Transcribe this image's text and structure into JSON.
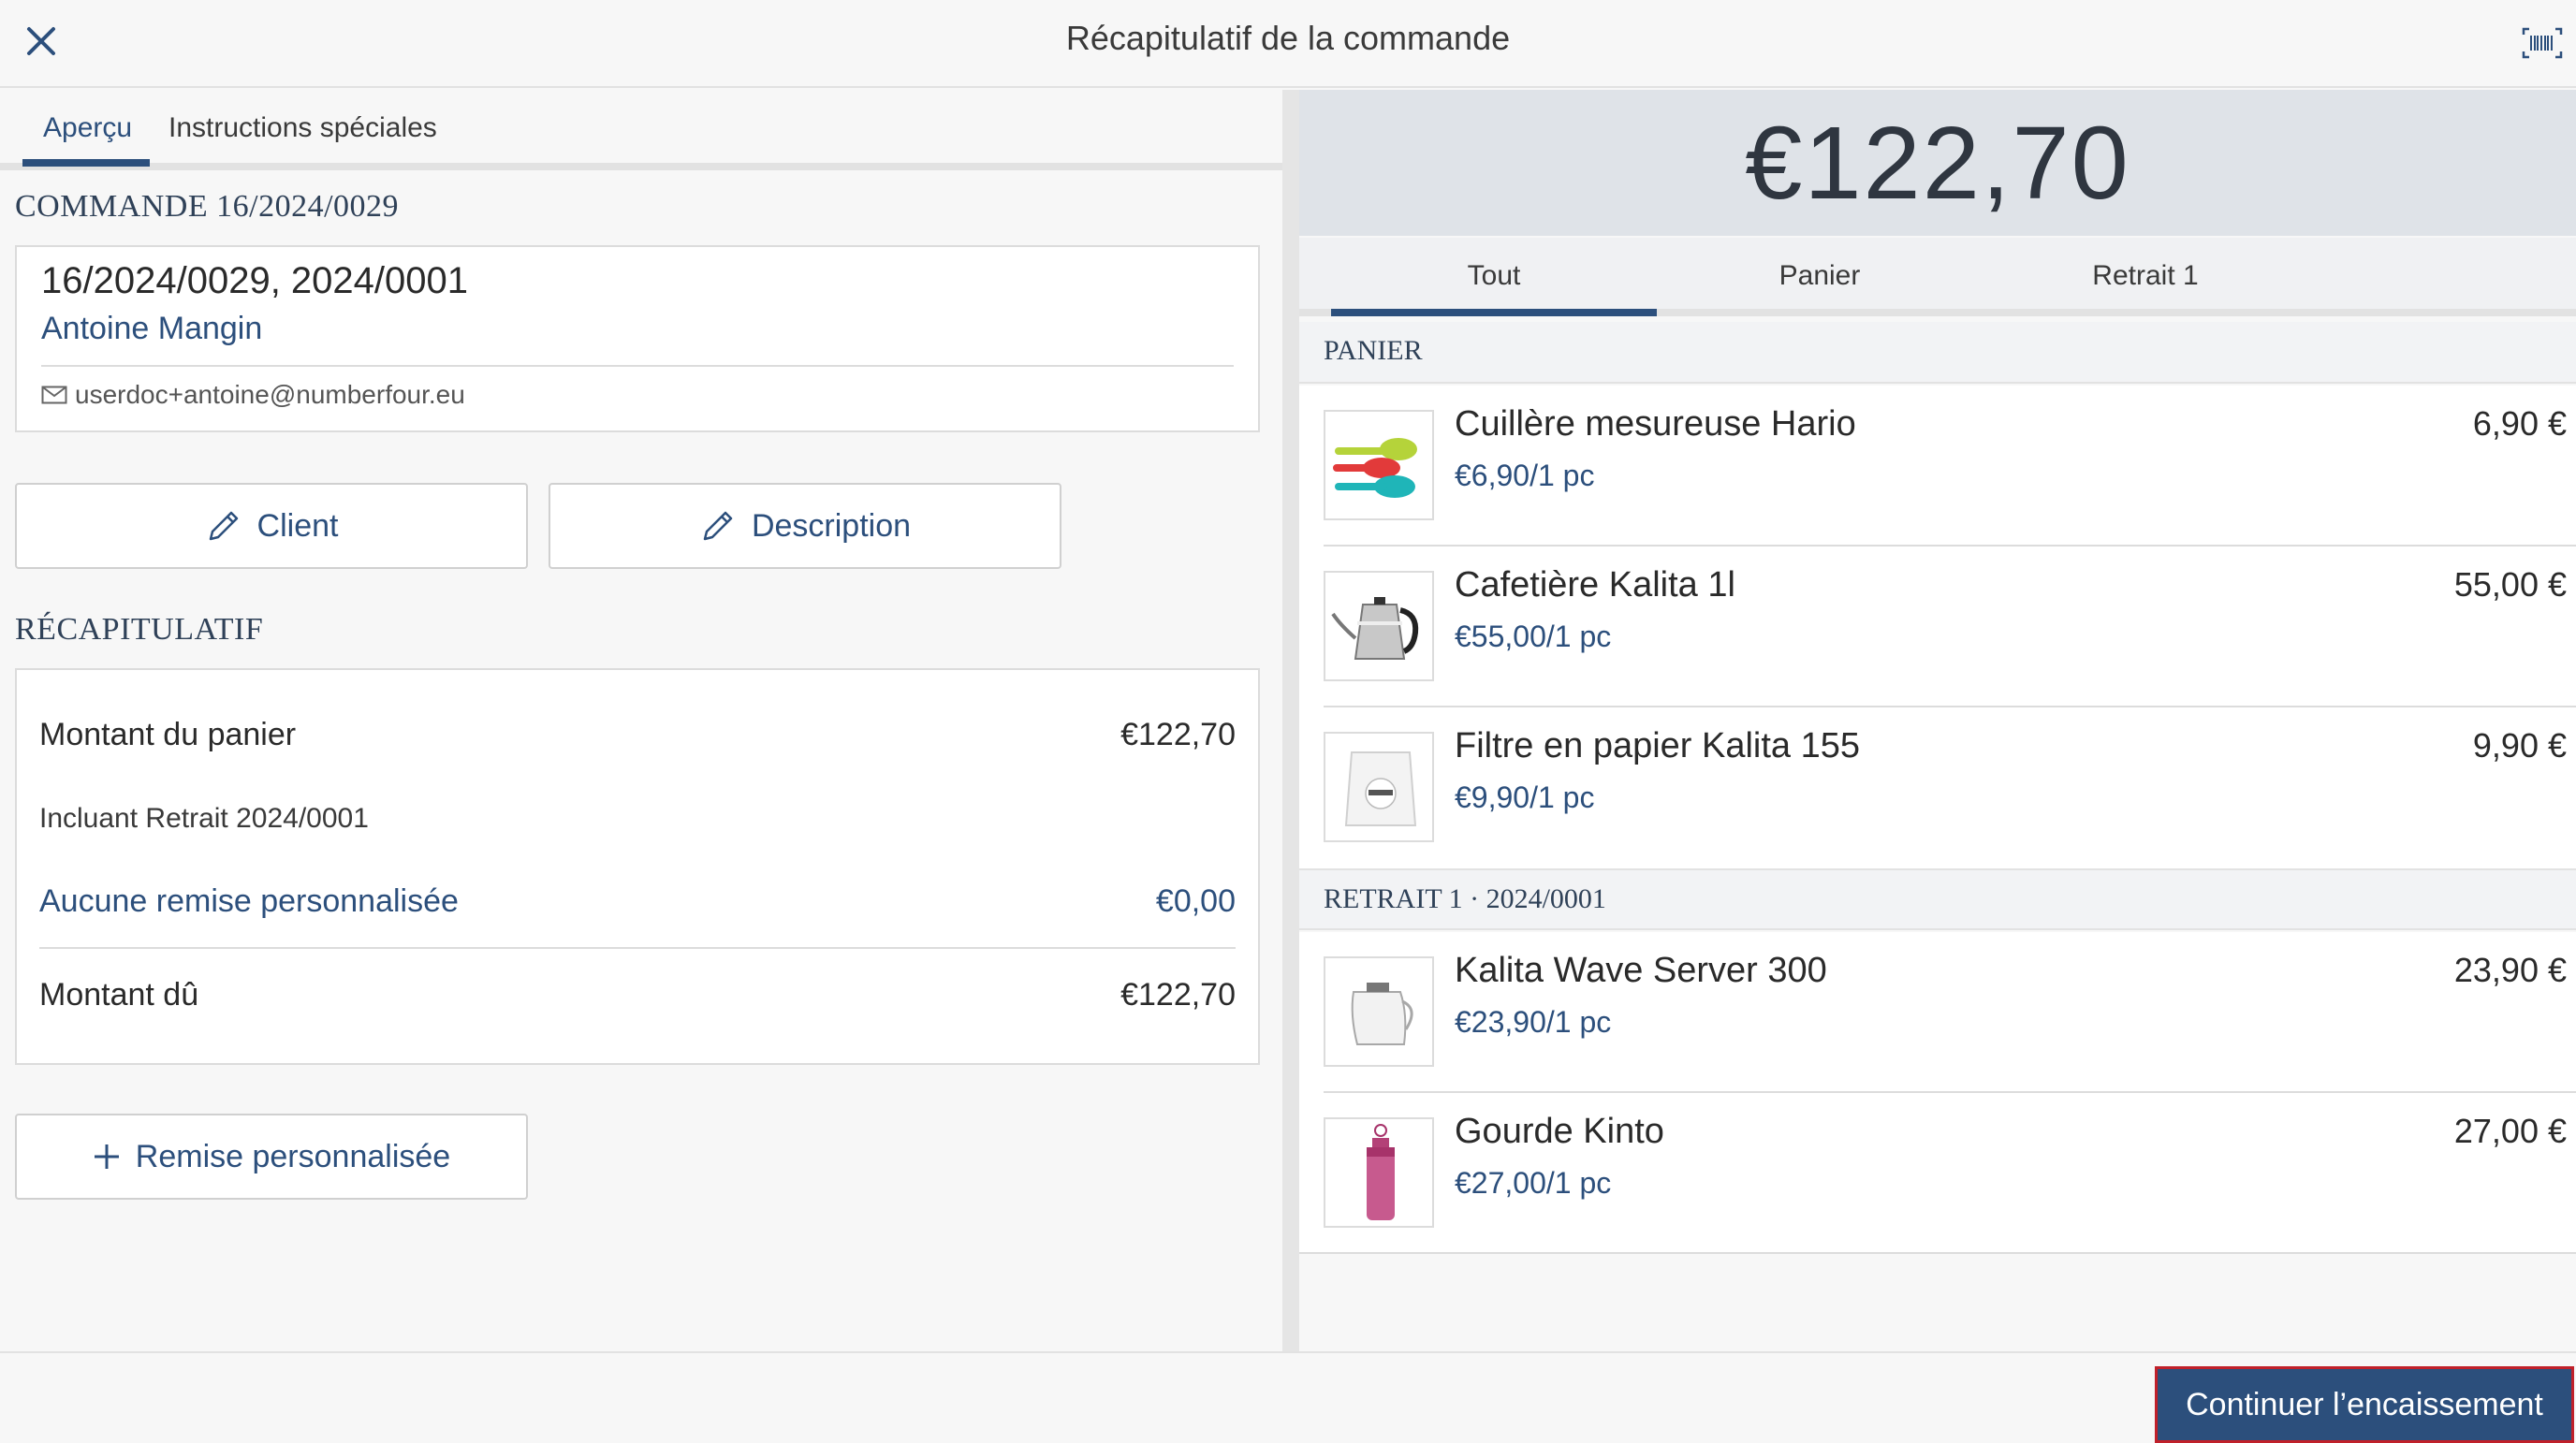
{
  "header": {
    "title": "Récapitulatif de la commande"
  },
  "left_tabs": [
    {
      "label": "Aperçu"
    },
    {
      "label": "Instructions spéciales"
    }
  ],
  "order": {
    "heading": "COMMANDE 16/2024/0029",
    "ids": "16/2024/0029, 2024/0001",
    "client_name": "Antoine Mangin",
    "email": "userdoc+antoine@numberfour.eu"
  },
  "edit_buttons": {
    "client_label": "Client",
    "description_label": "Description"
  },
  "summary": {
    "heading": "RÉCAPITULATIF",
    "cart_amount_label": "Montant du panier",
    "cart_amount_value": "€122,70",
    "including_text": "Incluant Retrait 2024/0001",
    "discount_label": "Aucune remise personnalisée",
    "discount_value": "€0,00",
    "due_label": "Montant dû",
    "due_value": "€122,70"
  },
  "custom_discount_button": "Remise personnalisée",
  "total": "€122,70",
  "right_tabs": [
    {
      "label": "Tout"
    },
    {
      "label": "Panier"
    },
    {
      "label": "Retrait 1"
    }
  ],
  "groups": [
    {
      "heading": "PANIER",
      "items": [
        {
          "name": "Cuillère mesureuse Hario",
          "unit": "€6,90/1 pc",
          "price": "6,90 €",
          "thumb": "measuring-spoons"
        },
        {
          "name": "Cafetière Kalita 1l",
          "unit": "€55,00/1 pc",
          "price": "55,00 €",
          "thumb": "kettle"
        },
        {
          "name": "Filtre en papier Kalita 155",
          "unit": "€9,90/1 pc",
          "price": "9,90 €",
          "thumb": "paper-filter"
        }
      ]
    },
    {
      "heading": "RETRAIT 1 · 2024/0001",
      "items": [
        {
          "name": "Kalita Wave Server 300",
          "unit": "€23,90/1 pc",
          "price": "23,90 €",
          "thumb": "glass-server"
        },
        {
          "name": "Gourde Kinto",
          "unit": "€27,00/1 pc",
          "price": "27,00 €",
          "thumb": "bottle"
        }
      ]
    }
  ],
  "footer": {
    "continue_label": "Continuer l’encaissement"
  },
  "colors": {
    "accent": "#2c4f7c",
    "focus_border": "#c0202a"
  }
}
